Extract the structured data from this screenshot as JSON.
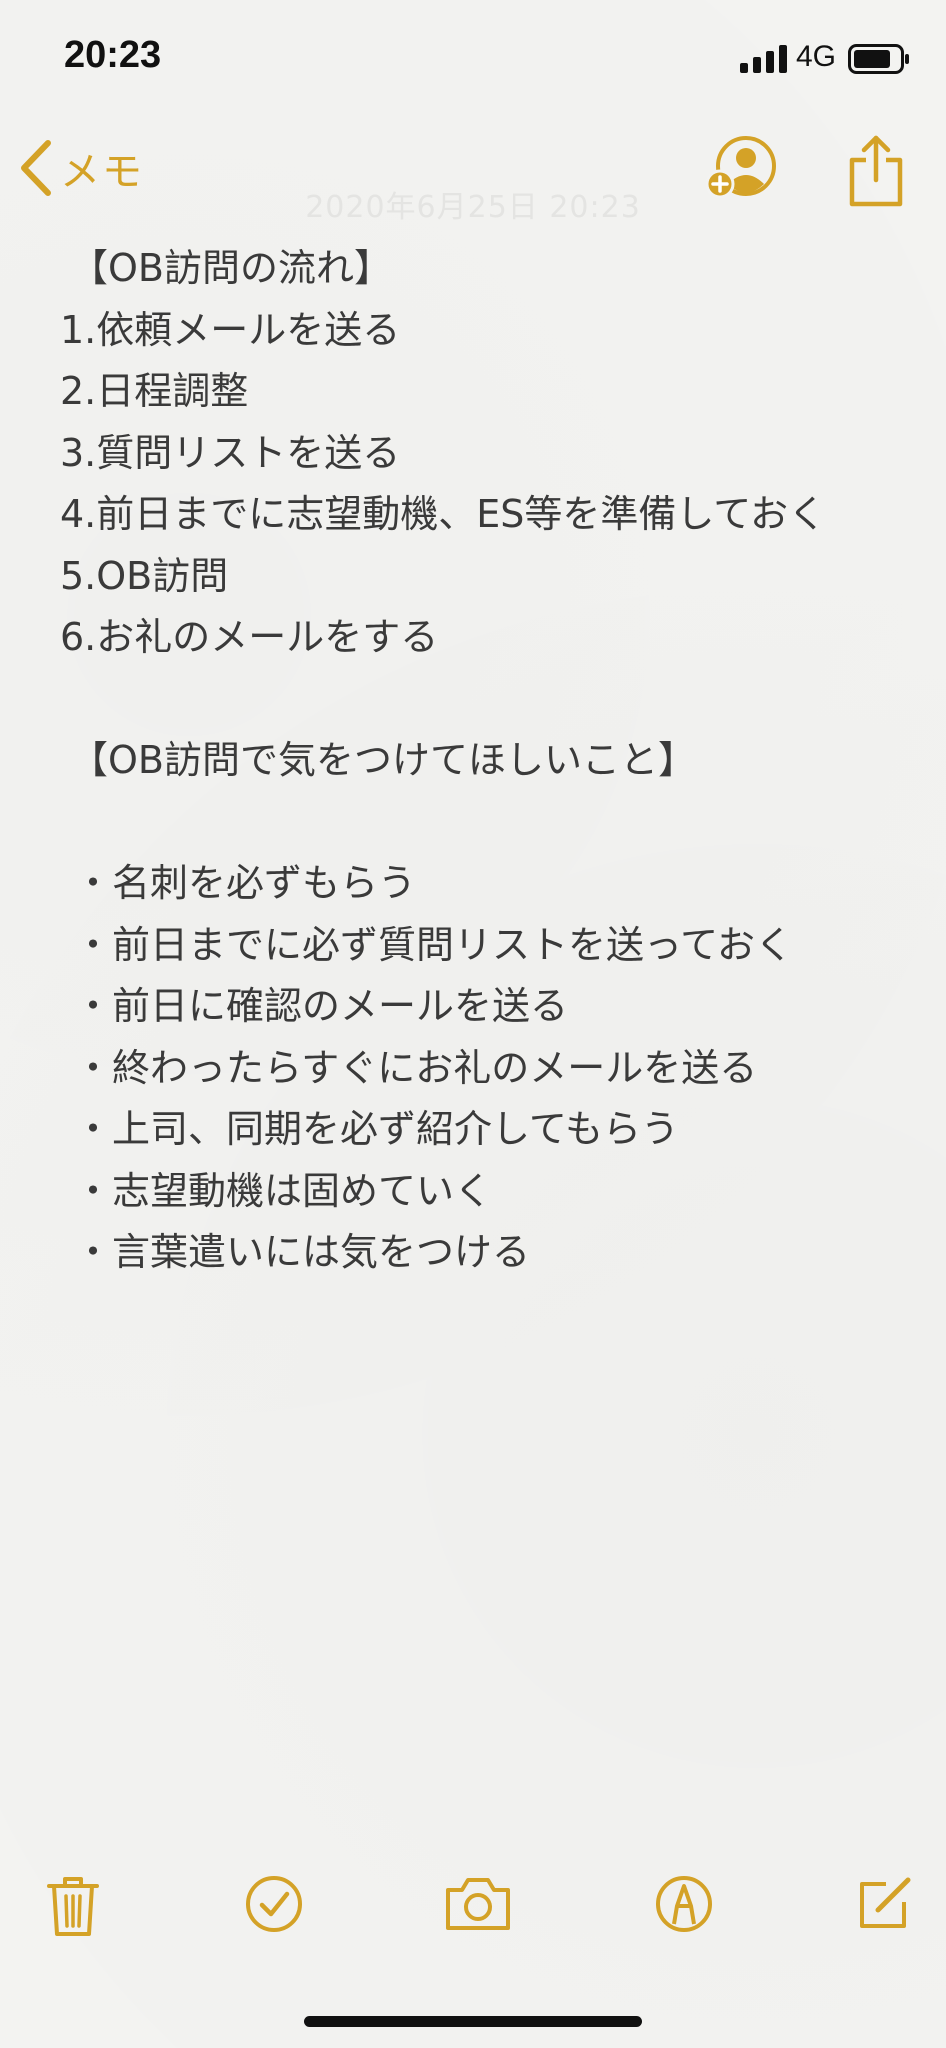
{
  "status_bar": {
    "time": "20:23",
    "network": "4G",
    "icons": [
      "signal-bars-icon",
      "battery-icon"
    ]
  },
  "nav": {
    "back_label": "メモ",
    "date": "2020年6月25日 20:23",
    "icons": [
      "chevron-left-icon",
      "add-person-icon",
      "share-icon"
    ],
    "accent_color": "#d4a227"
  },
  "note": {
    "flow_heading": "【OB訪問の流れ】",
    "flow_steps": [
      "1.依頼メールを送る",
      "2.日程調整",
      "3.質問リストを送る",
      "4.前日までに志望動機、ES等を準備しておく",
      "5.OB訪問",
      "6.お礼のメールをする"
    ],
    "tips_heading": "【OB訪問で気をつけてほしいこと】",
    "tips": [
      "・名刺を必ずもらう",
      "・前日までに必ず質問リストを送っておく",
      "・前日に確認のメールを送る",
      "・終わったらすぐにお礼のメールを送る",
      "・上司、同期を必ず紹介してもらう",
      "・志望動機は固めていく",
      "・言葉遣いには気をつける"
    ],
    "text_color": "#3a3a3a"
  },
  "toolbar": {
    "icons": [
      "trash-icon",
      "checklist-icon",
      "camera-icon",
      "markup-icon",
      "compose-icon"
    ]
  }
}
